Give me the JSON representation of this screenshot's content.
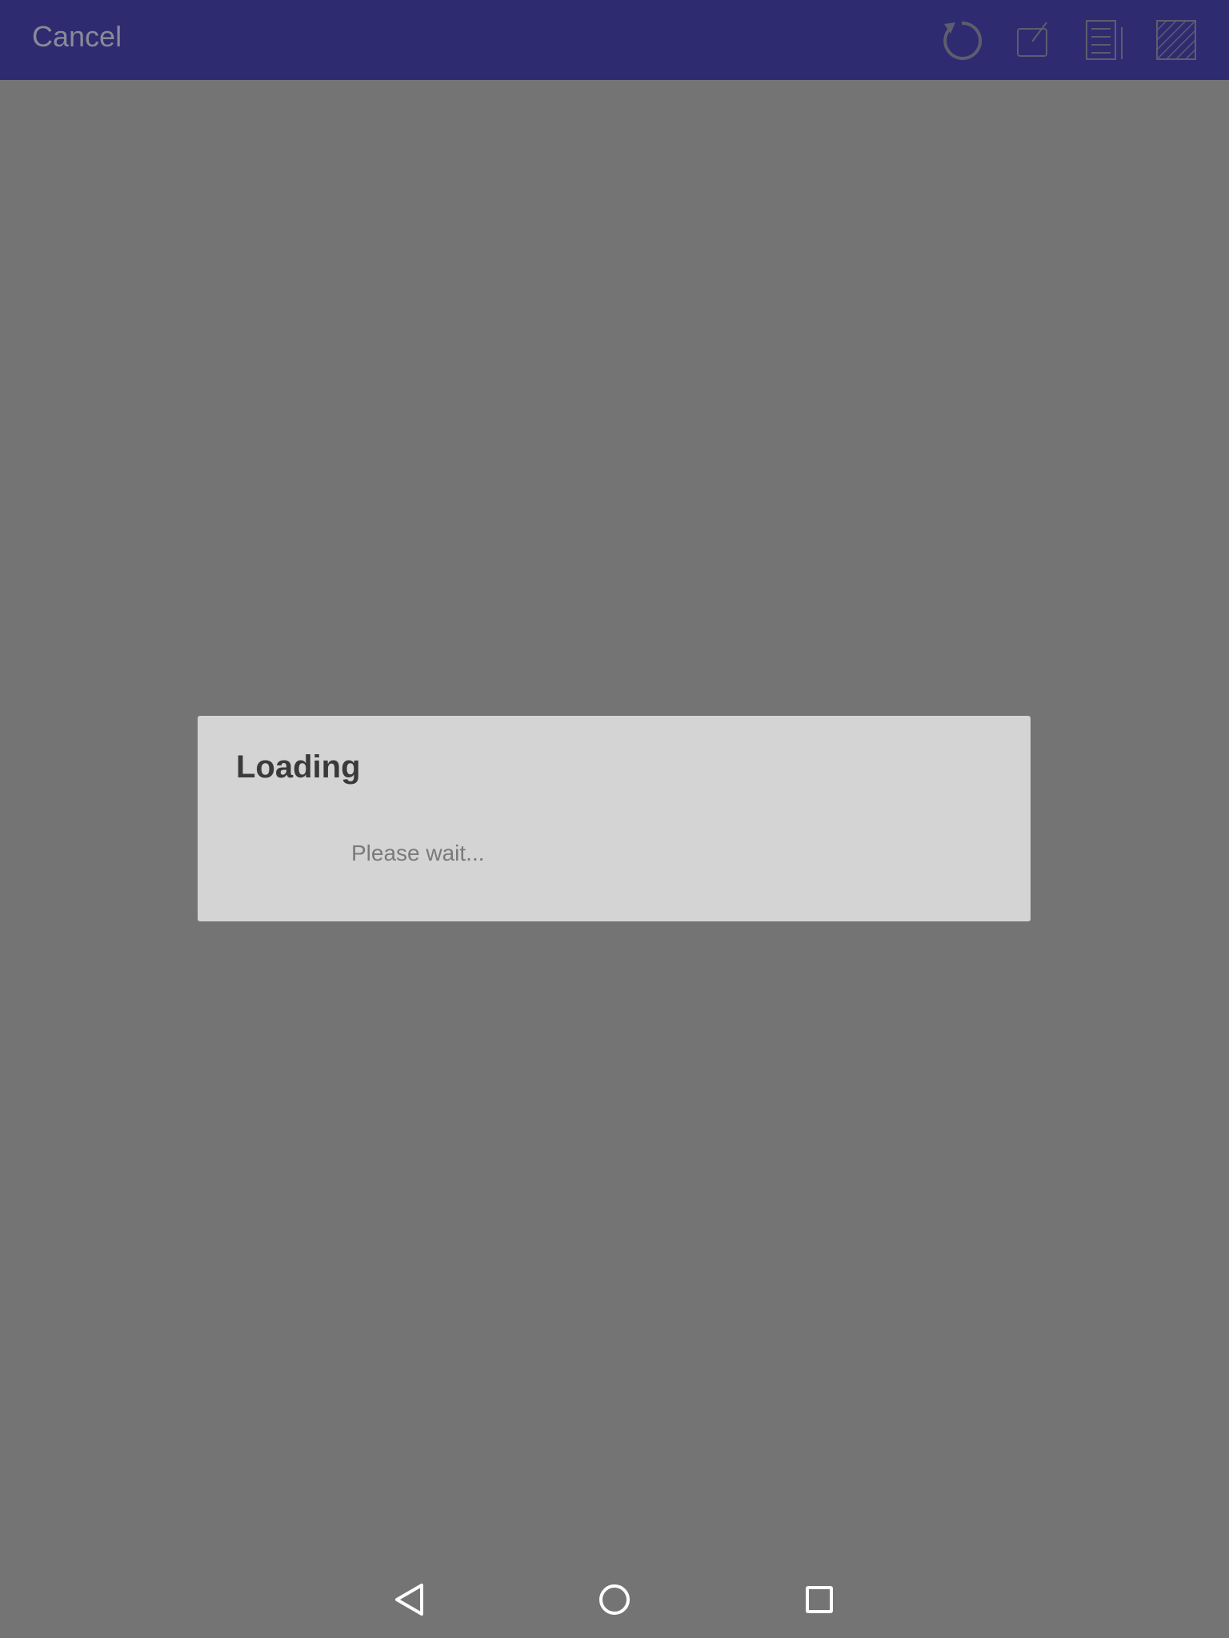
{
  "header": {
    "cancel_label": "Cancel",
    "background_color": "#2f2b71",
    "icons": [
      "refresh-icon",
      "edit-icon",
      "document-icon",
      "hatch-icon"
    ]
  },
  "dialog": {
    "title": "Loading",
    "message": "Please wait..."
  },
  "navigation": {
    "icons": [
      "back-icon",
      "home-icon",
      "recents-icon"
    ]
  },
  "colors": {
    "scrim": "#747474",
    "dialog_background": "#d4d4d4"
  }
}
